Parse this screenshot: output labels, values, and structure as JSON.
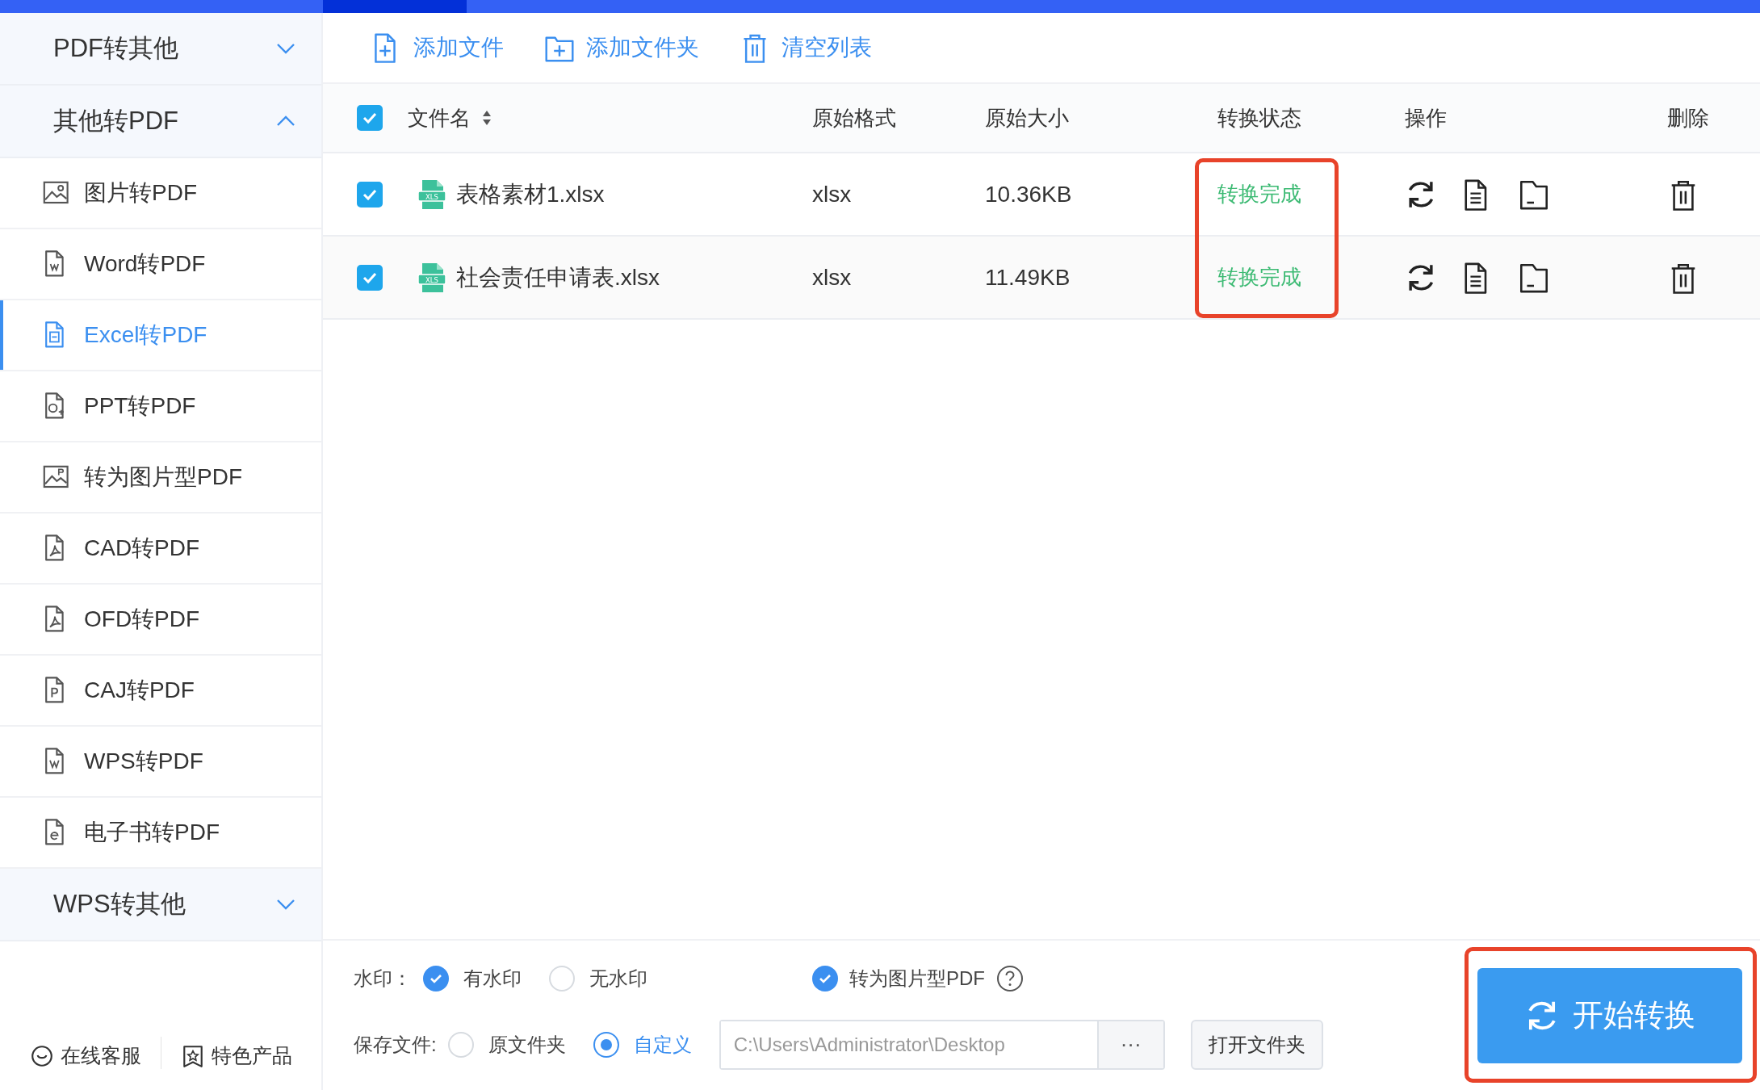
{
  "sidebar": {
    "groups": [
      {
        "label": "PDF转其他",
        "expanded": false
      },
      {
        "label": "其他转PDF",
        "expanded": true,
        "children": [
          {
            "label": "图片转PDF",
            "selected": false
          },
          {
            "label": "Word转PDF",
            "selected": false
          },
          {
            "label": "Excel转PDF",
            "selected": true
          },
          {
            "label": "PPT转PDF",
            "selected": false
          },
          {
            "label": "转为图片型PDF",
            "selected": false
          },
          {
            "label": "CAD转PDF",
            "selected": false
          },
          {
            "label": "OFD转PDF",
            "selected": false
          },
          {
            "label": "CAJ转PDF",
            "selected": false
          },
          {
            "label": "WPS转PDF",
            "selected": false
          },
          {
            "label": "电子书转PDF",
            "selected": false
          }
        ]
      },
      {
        "label": "WPS转其他",
        "expanded": false
      }
    ],
    "footer_links": [
      "在线客服",
      "特色产品"
    ]
  },
  "toolbar": [
    "添加文件",
    "添加文件夹",
    "清空列表"
  ],
  "table": {
    "select_all": true,
    "columns": [
      "文件名",
      "原始格式",
      "原始大小",
      "转换状态",
      "操作",
      "删除"
    ],
    "rows": [
      {
        "selected": true,
        "file_type": "XLS",
        "name": "表格素材1.xlsx",
        "format": "xlsx",
        "size": "10.36KB",
        "status": "转换完成"
      },
      {
        "selected": true,
        "file_type": "XLS",
        "name": "社会责任申请表.xlsx",
        "format": "xlsx",
        "size": "11.49KB",
        "status": "转换完成"
      }
    ]
  },
  "options": {
    "watermark": {
      "label": "水印：",
      "options": [
        {
          "label": "有水印",
          "selected": true
        },
        {
          "label": "无水印",
          "selected": false
        }
      ]
    },
    "image_pdf": {
      "label": "转为图片型PDF",
      "checked": true
    },
    "save": {
      "label": "保存文件:",
      "options": [
        {
          "label": "原文件夹",
          "selected": false
        },
        {
          "label": "自定义",
          "selected": true
        }
      ],
      "path": "C:\\Users\\Administrator\\Desktop",
      "browse": "···",
      "open_folder": "打开文件夹"
    }
  },
  "start_button": "开始转换"
}
